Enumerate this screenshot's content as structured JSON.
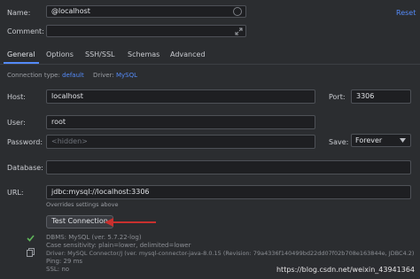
{
  "header": {
    "name_label": "Name:",
    "name_value": "@localhost",
    "reset_link": "Reset",
    "comment_label": "Comment:",
    "comment_value": ""
  },
  "tabs": [
    {
      "label": "General",
      "active": true
    },
    {
      "label": "Options",
      "active": false
    },
    {
      "label": "SSH/SSL",
      "active": false
    },
    {
      "label": "Schemas",
      "active": false
    },
    {
      "label": "Advanced",
      "active": false
    }
  ],
  "connection": {
    "type_label": "Connection type:",
    "type_value": "default",
    "driver_label": "Driver:",
    "driver_value": "MySQL"
  },
  "form": {
    "host_label": "Host:",
    "host_value": "localhost",
    "port_label": "Port:",
    "port_value": "3306",
    "user_label": "User:",
    "user_value": "root",
    "password_label": "Password:",
    "password_placeholder": "<hidden>",
    "save_label": "Save:",
    "save_value": "Forever",
    "database_label": "Database:",
    "database_value": "",
    "url_label": "URL:",
    "url_value": "jdbc:mysql://localhost:3306",
    "url_note": "Overrides settings above"
  },
  "test": {
    "button_label": "Test Connection",
    "result_lines": [
      "DBMS: MySQL (ver. 5.7.22-log)",
      "Case sensitivity: plain=lower, delimited=lower",
      "Driver: MySQL Connector/J (ver. mysql-connector-java-8.0.15 (Revision: 79a4336f140499bd22dd07f02b708e163844e, JDBC4.2)",
      "Ping: 29 ms",
      "SSL: no"
    ]
  },
  "watermark": "https://blog.csdn.net/weixin_43941364",
  "colors": {
    "background": "#2b2d30",
    "field": "#1e1f22",
    "link": "#548af7",
    "arrow": "#c8302e",
    "success": "#5fb65a"
  },
  "icons": {
    "name_field": "circle-icon",
    "comment_field": "expand-icon",
    "success": "checkmark-icon",
    "copy": "copy-icon",
    "dropdown": "chevron-down-icon"
  }
}
